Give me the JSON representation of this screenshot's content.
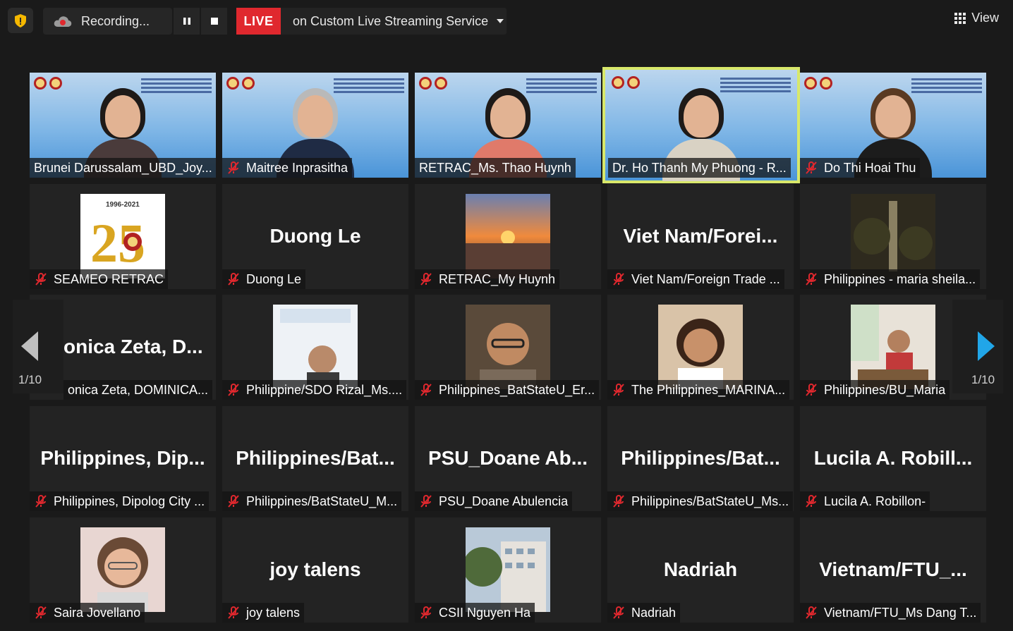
{
  "topbar": {
    "recording_label": "Recording...",
    "live_badge": "LIVE",
    "live_text": "on Custom Live Streaming Service",
    "view_label": "View"
  },
  "pager": {
    "left_page": "1/10",
    "right_page": "1/10"
  },
  "row1": [
    {
      "label": "Brunei Darussalam_UBD_Joy...",
      "muted": false
    },
    {
      "label": "Maitree Inprasitha",
      "muted": true
    },
    {
      "label": "RETRAC_Ms. Thao Huynh",
      "muted": false
    },
    {
      "label": "Dr. Ho Thanh My Phuong - R...",
      "muted": false,
      "active": true
    },
    {
      "label": "Do Thi Hoai Thu",
      "muted": true
    }
  ],
  "row2": [
    {
      "label": "SEAMEO RETRAC",
      "thumb": "25-years-logo",
      "logo_text": "1996-2021"
    },
    {
      "label": "Duong Le",
      "big": "Duong Le"
    },
    {
      "label": "RETRAC_My Huynh",
      "thumb": "sunset-photo"
    },
    {
      "label": "Viet Nam/Foreign Trade ...",
      "big": "Viet Nam/Forei..."
    },
    {
      "label": "Philippines - maria sheila...",
      "thumb": "tower-photo"
    }
  ],
  "row3": [
    {
      "label": "onica Zeta, DOMINICA...",
      "big": "onica Zeta, D..."
    },
    {
      "label": "Philippine/SDO Rizal_Ms....",
      "thumb": "doc-photo"
    },
    {
      "label": "Philippines_BatStateU_Er...",
      "thumb": "man-photo"
    },
    {
      "label": "The Philippines_MARINA...",
      "thumb": "woman-photo"
    },
    {
      "label": "Philippines/BU_Maria",
      "thumb": "office-photo"
    }
  ],
  "row4": [
    {
      "label": "Philippines, Dipolog City ...",
      "big": "Philippines, Dip..."
    },
    {
      "label": "Philippines/BatStateU_M...",
      "big": "Philippines/Bat..."
    },
    {
      "label": "PSU_Doane Abulencia",
      "big": "PSU_Doane Ab..."
    },
    {
      "label": "Philippines/BatStateU_Ms...",
      "big": "Philippines/Bat..."
    },
    {
      "label": "Lucila A. Robillon-",
      "big": "Lucila A. Robill..."
    }
  ],
  "row5": [
    {
      "label": "Saira Jovellano",
      "thumb": "girl-photo"
    },
    {
      "label": "joy talens",
      "big": "joy talens"
    },
    {
      "label": "CSII Nguyen Ha",
      "thumb": "building-photo"
    },
    {
      "label": "Nadriah",
      "big": "Nadriah"
    },
    {
      "label": "Vietnam/FTU_Ms Dang T...",
      "big": "Vietnam/FTU_..."
    }
  ],
  "colors": {
    "live_red": "#e0282e",
    "active_border": "#d8e86a",
    "arrow_blue": "#21a6e8",
    "mute_red": "#e0282e"
  }
}
